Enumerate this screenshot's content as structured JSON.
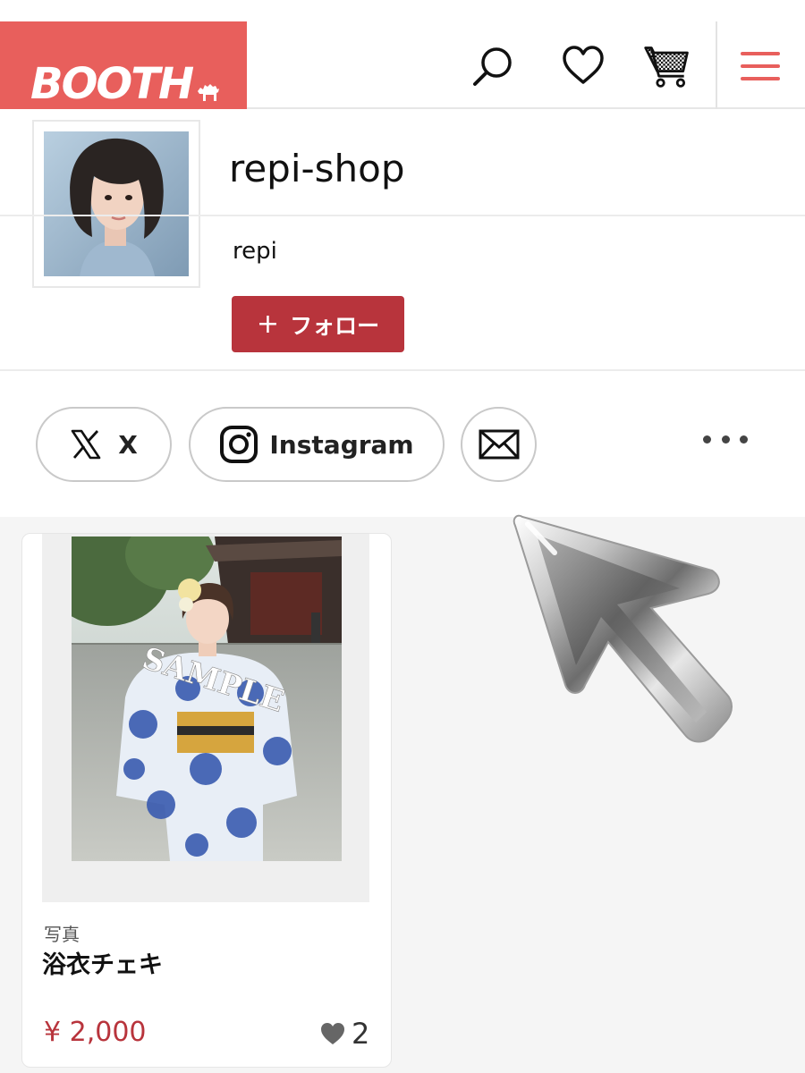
{
  "header": {
    "logo_text": "BOOTH",
    "brand_color": "#e85f5c",
    "icons": [
      "search-icon",
      "heart-icon",
      "cart-icon",
      "menu-icon"
    ]
  },
  "shop": {
    "name": "repi-shop",
    "owner": "repi",
    "follow_label": "フォロー",
    "follow_icon": "+",
    "accent_color": "#b8343c"
  },
  "social": {
    "links": [
      {
        "label": "X",
        "icon": "x-logo-icon"
      },
      {
        "label": "Instagram",
        "icon": "instagram-icon"
      },
      {
        "label": "",
        "icon": "mail-icon"
      }
    ],
    "more_icon": "more-dots-icon"
  },
  "products": [
    {
      "category": "写真",
      "title": "浴衣チェキ",
      "price": "¥ 2,000",
      "likes": "2",
      "watermark": "SAMPLE"
    }
  ]
}
